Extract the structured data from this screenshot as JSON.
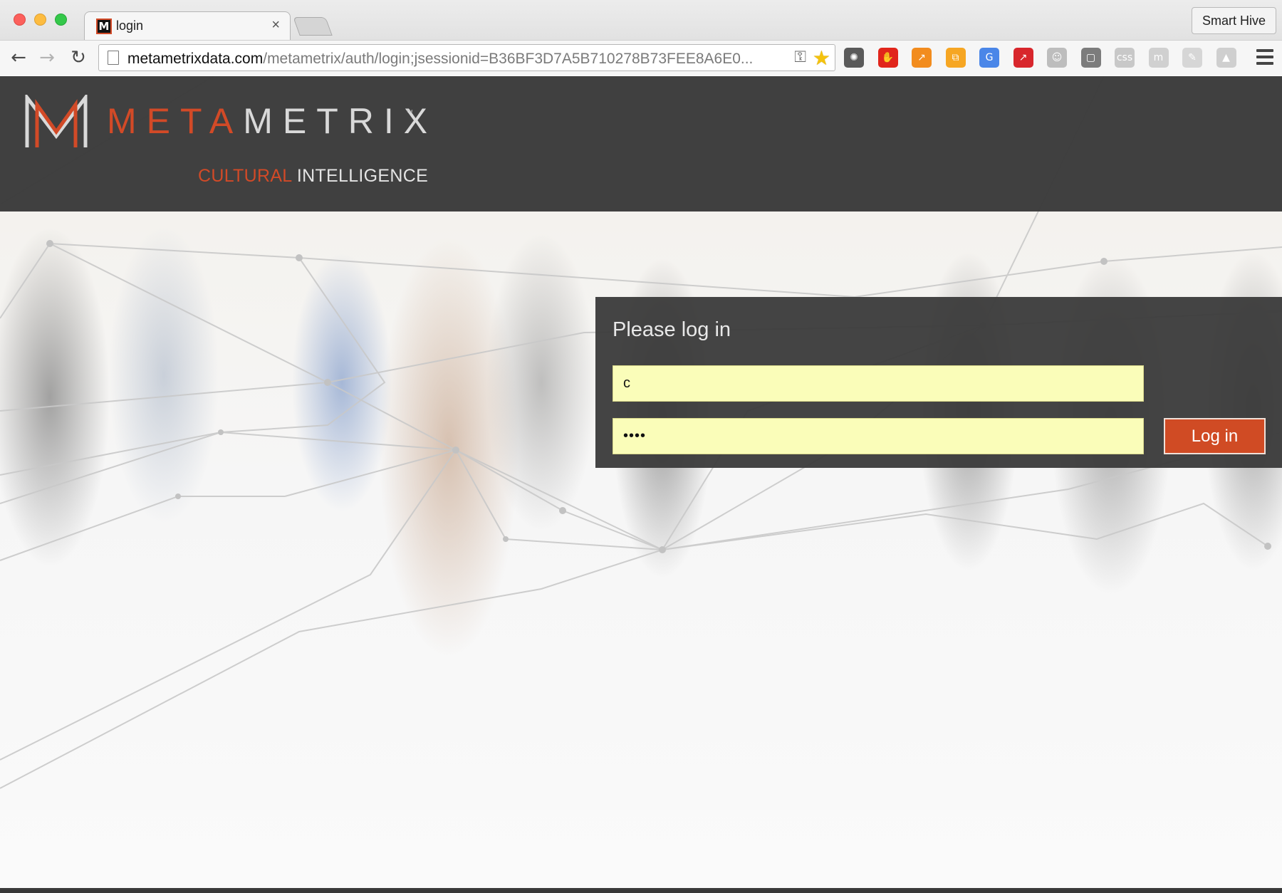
{
  "browser": {
    "tab_title": "login",
    "tab_favicon_letter": "M",
    "close_glyph": "×",
    "profile_name": "Smart Hive",
    "url_host": "metametrixdata.com",
    "url_path": "/metametrix/auth/login;jsessionid=B36BF3D7A5B710278B73FEE8A6E0...",
    "icons": [
      "back-arrow-icon",
      "forward-arrow-icon",
      "reload-icon",
      "page-icon",
      "key-icon",
      "star-icon",
      "menu-icon"
    ],
    "extensions": [
      {
        "name": "ext-spider-icon",
        "color": "#5a5a5a",
        "glyph": "✺"
      },
      {
        "name": "ext-adblock-icon",
        "color": "#e1251b",
        "glyph": "✋"
      },
      {
        "name": "ext-analytics-icon",
        "color": "#f28c1e",
        "glyph": "↗"
      },
      {
        "name": "ext-share-icon",
        "color": "#f6a623",
        "glyph": "⧉"
      },
      {
        "name": "ext-translate-icon",
        "color": "#4a86e8",
        "glyph": "G"
      },
      {
        "name": "ext-pdf-icon",
        "color": "#d8262c",
        "glyph": "↗"
      },
      {
        "name": "ext-head-icon",
        "color": "#bdbdbd",
        "glyph": "☺"
      },
      {
        "name": "ext-screenshot-icon",
        "color": "#7c7c7c",
        "glyph": "▢"
      },
      {
        "name": "ext-css-icon",
        "color": "#c8c8c8",
        "glyph": "css"
      },
      {
        "name": "ext-m-icon",
        "color": "#d0d0d0",
        "glyph": "m"
      },
      {
        "name": "ext-note-icon",
        "color": "#d6d6d6",
        "glyph": "✎"
      },
      {
        "name": "ext-drive-icon",
        "color": "#cfcfcf",
        "glyph": "▲"
      }
    ]
  },
  "header": {
    "brand_meta": "META",
    "brand_metrix": "METRIX",
    "trademark": "™",
    "tagline_cultural": "CULTURAL",
    "tagline_intelligence": "INTELLIGENCE",
    "accent_color": "#d24a27"
  },
  "login": {
    "title": "Please log in",
    "username_value": "c",
    "password_value": "••••",
    "button_label": "Log in",
    "field_color": "#fafdb9"
  }
}
